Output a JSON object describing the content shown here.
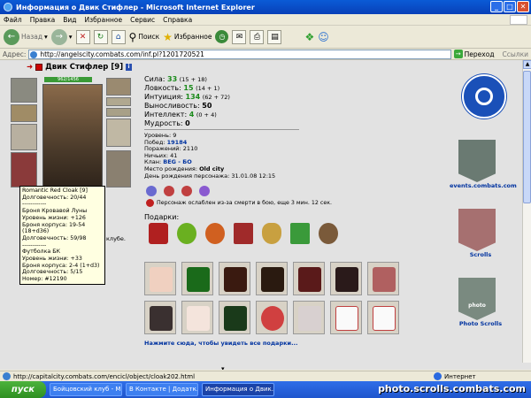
{
  "window": {
    "title": "Информация о Двик Стифлер - Microsoft Internet Explorer"
  },
  "menu": [
    "Файл",
    "Правка",
    "Вид",
    "Избранное",
    "Сервис",
    "Справка"
  ],
  "toolbar": {
    "back": "Назад",
    "search": "Поиск",
    "favorites": "Избранное"
  },
  "address": {
    "label": "Адрес:",
    "url": "http://angelscity.combats.com/inf.pl?1201720521",
    "go": "Переход",
    "links": "Ссылки"
  },
  "character": {
    "name": "Двик Стифлер",
    "level": "[9]",
    "hp": "962/1456",
    "stats": [
      {
        "label": "Сила:",
        "value": "33",
        "extra": "(15 + 18)"
      },
      {
        "label": "Ловкость:",
        "value": "15",
        "extra": "(14 + 1)"
      },
      {
        "label": "Интуиция:",
        "value": "134",
        "extra": "(62 + 72)"
      },
      {
        "label": "Выносливость:",
        "value": "50",
        "extra": ""
      },
      {
        "label": "Интеллект:",
        "value": "4",
        "extra": "(0 + 4)"
      },
      {
        "label": "Мудрость:",
        "value": "0",
        "extra": ""
      }
    ],
    "info": [
      {
        "label": "Уровень:",
        "value": "9"
      },
      {
        "label": "Побед:",
        "value": "19184"
      },
      {
        "label": "Поражений:",
        "value": "2110"
      },
      {
        "label": "Ничьих:",
        "value": "41"
      },
      {
        "label": "Клан:",
        "value": "BEG - БО"
      },
      {
        "label": "Место рождения:",
        "value": "Old city"
      },
      {
        "label": "День рождения персонажа:",
        "value": "31.01.08 12:15"
      }
    ],
    "weakness": "Персонаж ослаблен из-за смерти в бою, еще 3 мин. 12 сек.",
    "gifts_label": "Подарки:",
    "gifts_more": "Нажмите сюда, чтобы увидеть все подарки...",
    "club": "клубе."
  },
  "tooltip": [
    "Romantic Red Cloak [9]",
    "Долговечность: 20/44",
    "------------",
    "Броня Кровавой Луны",
    "Уровень жизни: +126",
    "Броня корпуса: 19-54 (18+d36)",
    "Долговечность: 59/98",
    "------------",
    "Футболка БК",
    "Уровень жизни: +33",
    "Броня корпуса: 2-4 (1+d3)",
    "Долговечность: 5/15",
    "Номер: #12190"
  ],
  "right": {
    "events": "events.combats.com",
    "scrolls": "Scrolls",
    "photo": "Photo Scrolls",
    "photo_inner": "photo"
  },
  "status": {
    "url": "http://capitalcity.combats.com/encicl/object/cloak202.html",
    "zone": "Интернет"
  },
  "taskbar": {
    "start": "пуск",
    "tasks": [
      "Бойцовский клуб - M...",
      "В Контакте | Додатк...",
      "Информация о Двик..."
    ]
  },
  "watermark": "photo.scrolls.combats.com"
}
